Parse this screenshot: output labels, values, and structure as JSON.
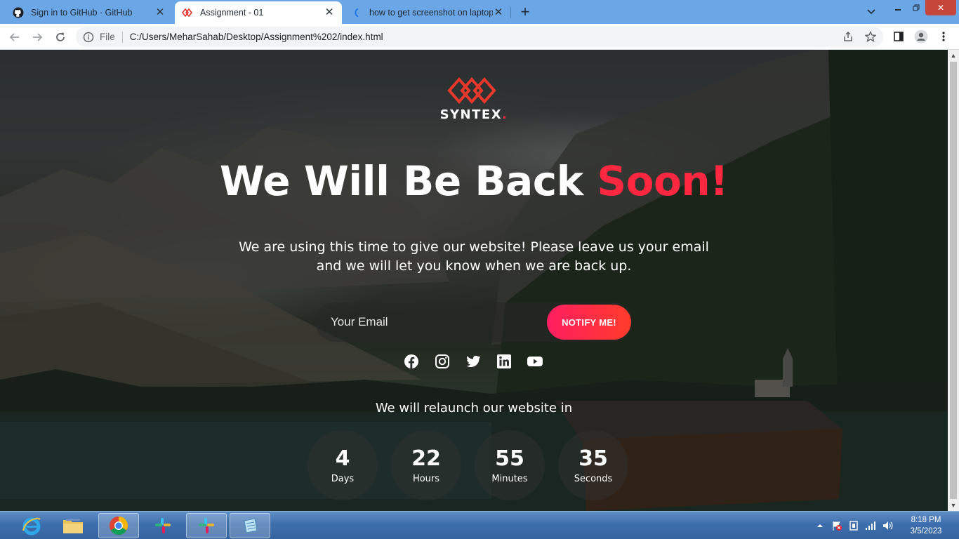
{
  "browser": {
    "tabs": [
      {
        "title": "Sign in to GitHub · GitHub",
        "icon": "github-icon",
        "active": false
      },
      {
        "title": "Assignment - 01",
        "icon": "syntex-logo-icon",
        "active": true
      },
      {
        "title": "how to get screenshot on laptop",
        "icon": "loading-icon",
        "active": false
      }
    ],
    "address": {
      "scheme_label": "File",
      "url": "C:/Users/MeharSahab/Desktop/Assignment%202/index.html"
    }
  },
  "page": {
    "brand": {
      "name": "SYNTEX",
      "dot": "."
    },
    "headline": {
      "main": "We Will Be Back ",
      "accent": "Soon!"
    },
    "description": "We are using this time to give our website! Please leave us your email and we will let you know when we are back up.",
    "form": {
      "email_placeholder": "Your Email",
      "button_label": "NOTIFY ME!"
    },
    "socials": [
      "facebook-icon",
      "instagram-icon",
      "twitter-icon",
      "linkedin-icon",
      "youtube-icon"
    ],
    "relaunch_text": "We will relaunch our website in",
    "countdown": [
      {
        "value": "4",
        "label": "Days"
      },
      {
        "value": "22",
        "label": "Hours"
      },
      {
        "value": "55",
        "label": "Minutes"
      },
      {
        "value": "35",
        "label": "Seconds"
      }
    ],
    "colors": {
      "accent": "#ff2840",
      "button_start": "#ff1f62",
      "button_end": "#ff3b2b"
    }
  },
  "taskbar": {
    "apps": [
      "internet-explorer-icon",
      "file-explorer-icon",
      "chrome-icon",
      "slack-icon",
      "slack-icon",
      "notepad-icon"
    ],
    "clock": {
      "time": "8:18 PM",
      "date": "3/5/2023"
    }
  }
}
